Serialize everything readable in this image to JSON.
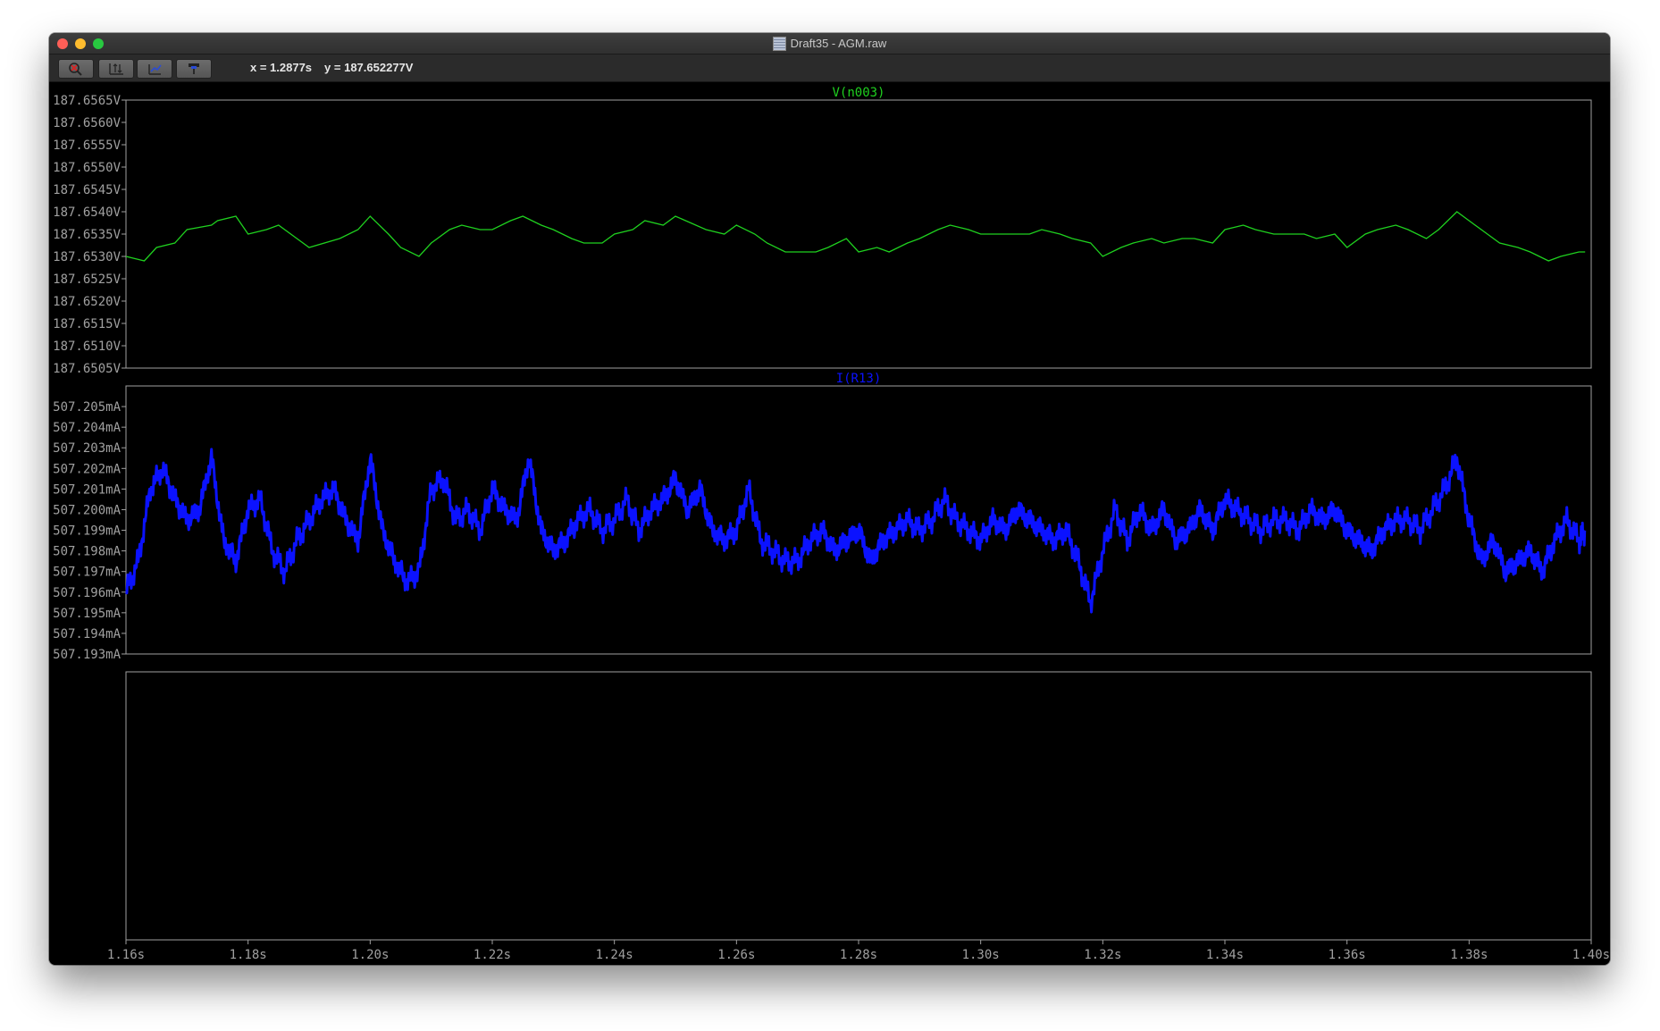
{
  "window": {
    "title": "Draft35 - AGM.raw"
  },
  "toolbar": {
    "buttons": [
      {
        "name": "zoom-cancel-icon"
      },
      {
        "name": "autoscale-icon"
      },
      {
        "name": "pan-icon"
      },
      {
        "name": "probe-icon"
      }
    ],
    "readout_x": "x = 1.2877s",
    "readout_y": "y = 187.652277V"
  },
  "colors": {
    "background": "#000000",
    "axis": "#a0a0a0",
    "series1": "#1fd11f",
    "series2": "#0b12ff"
  },
  "chart_data": [
    {
      "type": "line",
      "title": "V(n003)",
      "x_unit": "s",
      "y_unit": "V",
      "xlim": [
        1.16,
        1.4
      ],
      "ylim": [
        187.6505,
        187.6565
      ],
      "x_ticks": [
        "1.16s",
        "1.18s",
        "1.20s",
        "1.22s",
        "1.24s",
        "1.26s",
        "1.28s",
        "1.30s",
        "1.32s",
        "1.34s",
        "1.36s",
        "1.38s",
        "1.40s"
      ],
      "y_ticks": [
        "187.6565V",
        "187.6560V",
        "187.6555V",
        "187.6550V",
        "187.6545V",
        "187.6540V",
        "187.6535V",
        "187.6530V",
        "187.6525V",
        "187.6520V",
        "187.6515V",
        "187.6510V",
        "187.6505V"
      ],
      "series": [
        {
          "name": "V(n003)",
          "x": [
            1.16,
            1.163,
            1.165,
            1.168,
            1.17,
            1.174,
            1.175,
            1.178,
            1.18,
            1.183,
            1.185,
            1.188,
            1.19,
            1.195,
            1.198,
            1.2,
            1.203,
            1.205,
            1.208,
            1.21,
            1.213,
            1.215,
            1.218,
            1.22,
            1.223,
            1.225,
            1.228,
            1.23,
            1.233,
            1.235,
            1.238,
            1.24,
            1.243,
            1.245,
            1.248,
            1.25,
            1.255,
            1.258,
            1.26,
            1.263,
            1.265,
            1.268,
            1.27,
            1.273,
            1.275,
            1.278,
            1.28,
            1.283,
            1.285,
            1.288,
            1.29,
            1.293,
            1.295,
            1.298,
            1.3,
            1.303,
            1.305,
            1.308,
            1.31,
            1.313,
            1.315,
            1.318,
            1.32,
            1.323,
            1.325,
            1.328,
            1.33,
            1.333,
            1.335,
            1.338,
            1.34,
            1.343,
            1.345,
            1.348,
            1.35,
            1.353,
            1.355,
            1.358,
            1.36,
            1.363,
            1.365,
            1.368,
            1.37,
            1.373,
            1.375,
            1.378,
            1.38,
            1.383,
            1.385,
            1.388,
            1.39,
            1.393,
            1.395,
            1.398,
            1.399
          ],
          "y": [
            187.653,
            187.6529,
            187.6532,
            187.6533,
            187.6536,
            187.6537,
            187.6538,
            187.6539,
            187.6535,
            187.6536,
            187.6537,
            187.6534,
            187.6532,
            187.6534,
            187.6536,
            187.6539,
            187.6535,
            187.6532,
            187.653,
            187.6533,
            187.6536,
            187.6537,
            187.6536,
            187.6536,
            187.6538,
            187.6539,
            187.6537,
            187.6536,
            187.6534,
            187.6533,
            187.6533,
            187.6535,
            187.6536,
            187.6538,
            187.6537,
            187.6539,
            187.6536,
            187.6535,
            187.6537,
            187.6535,
            187.6533,
            187.6531,
            187.6531,
            187.6531,
            187.6532,
            187.6534,
            187.6531,
            187.6532,
            187.6531,
            187.6533,
            187.6534,
            187.6536,
            187.6537,
            187.6536,
            187.6535,
            187.6535,
            187.6535,
            187.6535,
            187.6536,
            187.6535,
            187.6534,
            187.6533,
            187.653,
            187.6532,
            187.6533,
            187.6534,
            187.6533,
            187.6534,
            187.6534,
            187.6533,
            187.6536,
            187.6537,
            187.6536,
            187.6535,
            187.6535,
            187.6535,
            187.6534,
            187.6535,
            187.6532,
            187.6535,
            187.6536,
            187.6537,
            187.6536,
            187.6534,
            187.6536,
            187.654,
            187.6538,
            187.6535,
            187.6533,
            187.6532,
            187.6531,
            187.6529,
            187.653,
            187.6531,
            187.6531
          ]
        }
      ]
    },
    {
      "type": "line",
      "title": "I(R13)",
      "x_unit": "s",
      "y_unit": "mA",
      "xlim": [
        1.16,
        1.4
      ],
      "ylim": [
        507.193,
        507.206
      ],
      "x_ticks": [
        "1.16s",
        "1.18s",
        "1.20s",
        "1.22s",
        "1.24s",
        "1.26s",
        "1.28s",
        "1.30s",
        "1.32s",
        "1.34s",
        "1.36s",
        "1.38s",
        "1.40s"
      ],
      "y_ticks": [
        "507.205mA",
        "507.204mA",
        "507.203mA",
        "507.202mA",
        "507.201mA",
        "507.200mA",
        "507.199mA",
        "507.198mA",
        "507.197mA",
        "507.196mA",
        "507.195mA",
        "507.194mA",
        "507.193mA"
      ],
      "series": [
        {
          "name": "I(R13)",
          "x": [
            1.16,
            1.162,
            1.164,
            1.166,
            1.168,
            1.17,
            1.172,
            1.174,
            1.176,
            1.178,
            1.18,
            1.182,
            1.184,
            1.186,
            1.188,
            1.19,
            1.192,
            1.194,
            1.196,
            1.198,
            1.2,
            1.202,
            1.204,
            1.206,
            1.208,
            1.21,
            1.212,
            1.214,
            1.216,
            1.218,
            1.22,
            1.222,
            1.224,
            1.226,
            1.228,
            1.23,
            1.232,
            1.234,
            1.236,
            1.238,
            1.24,
            1.242,
            1.244,
            1.246,
            1.248,
            1.25,
            1.252,
            1.254,
            1.256,
            1.258,
            1.26,
            1.262,
            1.264,
            1.266,
            1.268,
            1.27,
            1.272,
            1.274,
            1.276,
            1.278,
            1.28,
            1.282,
            1.284,
            1.286,
            1.288,
            1.29,
            1.292,
            1.294,
            1.296,
            1.298,
            1.3,
            1.302,
            1.304,
            1.306,
            1.308,
            1.31,
            1.312,
            1.314,
            1.316,
            1.318,
            1.32,
            1.322,
            1.324,
            1.326,
            1.328,
            1.33,
            1.332,
            1.334,
            1.336,
            1.338,
            1.34,
            1.342,
            1.344,
            1.346,
            1.348,
            1.35,
            1.352,
            1.354,
            1.356,
            1.358,
            1.36,
            1.362,
            1.364,
            1.366,
            1.368,
            1.37,
            1.372,
            1.374,
            1.376,
            1.378,
            1.38,
            1.382,
            1.384,
            1.386,
            1.388,
            1.39,
            1.392,
            1.394,
            1.396,
            1.398,
            1.399
          ],
          "y": [
            507.196,
            507.1975,
            507.201,
            507.202,
            507.2005,
            507.1995,
            507.2,
            507.2025,
            507.1985,
            507.1975,
            507.2,
            507.2005,
            507.198,
            507.197,
            507.1985,
            507.1995,
            507.2005,
            507.201,
            507.1995,
            507.1985,
            507.2025,
            507.199,
            507.1975,
            507.1965,
            507.197,
            507.201,
            507.2015,
            507.1995,
            507.2,
            507.199,
            507.201,
            507.2,
            507.1995,
            507.2025,
            507.199,
            507.198,
            507.1985,
            507.1995,
            507.2,
            507.199,
            507.1995,
            507.2005,
            507.199,
            507.2,
            507.2005,
            507.2015,
            507.2,
            507.201,
            507.199,
            507.1985,
            507.199,
            507.201,
            507.1985,
            507.198,
            507.1975,
            507.1975,
            507.1985,
            507.199,
            507.198,
            507.1985,
            507.199,
            507.1975,
            507.1985,
            507.199,
            507.1995,
            507.199,
            507.1995,
            507.2005,
            507.1995,
            507.199,
            507.1985,
            507.1995,
            507.199,
            507.2,
            507.1995,
            507.199,
            507.1985,
            507.199,
            507.1975,
            507.1955,
            507.198,
            507.2,
            507.1985,
            507.2,
            507.199,
            507.2,
            507.1985,
            507.199,
            507.2,
            507.199,
            507.2005,
            507.2,
            507.1995,
            507.199,
            507.1995,
            507.1995,
            507.199,
            507.2,
            507.1995,
            507.2,
            507.199,
            507.1985,
            507.198,
            507.199,
            507.1995,
            507.1995,
            507.199,
            507.2,
            507.201,
            507.2025,
            507.1995,
            507.1975,
            507.1985,
            507.197,
            507.1975,
            507.198,
            507.197,
            507.1985,
            507.1995,
            507.1985,
            507.199
          ]
        }
      ]
    },
    {
      "type": "line",
      "title": "",
      "xlim": [
        1.16,
        1.4
      ],
      "series": []
    }
  ]
}
